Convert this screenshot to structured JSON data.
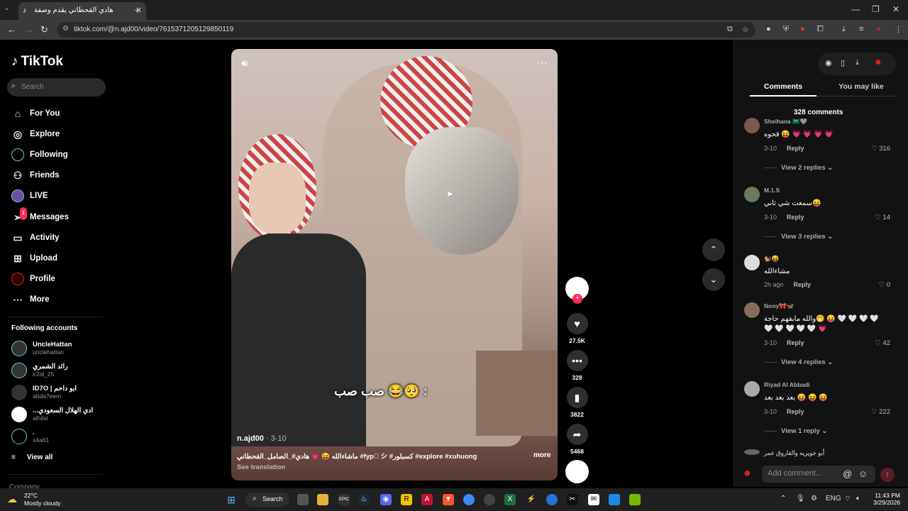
{
  "browser": {
    "tab_title": "هادي القحطاني يقدم وصفة",
    "url": "tiktok.com/@n.ajd00/video/7615371205129850119"
  },
  "sidebar": {
    "logo": "TikTok",
    "search_placeholder": "Search",
    "nav": [
      {
        "label": "For You",
        "icon": "home-icon"
      },
      {
        "label": "Explore",
        "icon": "compass-icon"
      },
      {
        "label": "Following",
        "icon": "following-icon"
      },
      {
        "label": "Friends",
        "icon": "friends-icon"
      },
      {
        "label": "LIVE",
        "icon": "live-icon"
      },
      {
        "label": "Messages",
        "icon": "messages-icon",
        "badge": "1"
      },
      {
        "label": "Activity",
        "icon": "activity-icon"
      },
      {
        "label": "Upload",
        "icon": "upload-icon"
      },
      {
        "label": "Profile",
        "icon": "profile-icon"
      },
      {
        "label": "More",
        "icon": "more-icon"
      }
    ],
    "following_title": "Following accounts",
    "accounts": [
      {
        "name": "UncleHattan",
        "handle": "unclehattan"
      },
      {
        "name": "رائد الشمري",
        "handle": "ir2id_25"
      },
      {
        "name": "ID7O | ابو داحم",
        "handle": "abda7eem"
      },
      {
        "name": "...ادي الهلال السعودي",
        "handle": "alhilal"
      },
      {
        "name": ".",
        "handle": "x4a61"
      }
    ],
    "view_all": "View all",
    "company": "Company"
  },
  "video": {
    "overlay_text": "صب صب 😂🥺 :",
    "author": "n.ajd00",
    "date": "· 3-10",
    "description": "ماشاءالله 😝 💗 هادي#_الصامل_القحطاني #fyp゚ シ #كسبلور #explore #xuhuong",
    "more": "more",
    "see_translation": "See translation"
  },
  "actions": {
    "likes": "27.5K",
    "comments": "328",
    "saves": "3822",
    "shares": "5468"
  },
  "panel": {
    "tab_comments": "Comments",
    "tab_like": "You may like",
    "count": "328 comments",
    "comments": [
      {
        "name": "Sheihana 🇸🇦🩶",
        "text": "قحوه 😝 💗 💗 💗 💗",
        "date": "3-10",
        "reply": "Reply",
        "likes": "316",
        "replies": "View 2 replies"
      },
      {
        "name": "M.1.S",
        "text": "سمعت شي ثاني😝",
        "date": "3-10",
        "reply": "Reply",
        "likes": "14",
        "replies": "View 3 replies"
      },
      {
        "name": "🐿️😝",
        "text": "مشاءالله",
        "date": "2h ago",
        "reply": "Reply",
        "likes": "0",
        "replies": ""
      },
      {
        "name": "Nony🎀🦋",
        "text": "والله مابفهم حاجة🤭 😝 🤍 🤍 🤍 🤍 🤍 🤍 🤍 🤍 🤍 💗",
        "date": "3-10",
        "reply": "Reply",
        "likes": "42",
        "replies": "View 4 replies"
      },
      {
        "name": "Riyad Al Abbadi",
        "text": "بعد بعد بعد 😝 😝 😝",
        "date": "3-10",
        "reply": "Reply",
        "likes": "222",
        "replies": "View 1 reply"
      },
      {
        "name": "أبو جويريه والفاروق عمر",
        "text": "",
        "date": "",
        "reply": "",
        "likes": "",
        "replies": ""
      }
    ],
    "add_comment": "Add comment..."
  },
  "taskbar": {
    "temp": "22°C",
    "condition": "Mostly cloudy",
    "search": "Search",
    "lang": "ENG",
    "time": "11:43 PM",
    "date": "3/29/2026"
  }
}
